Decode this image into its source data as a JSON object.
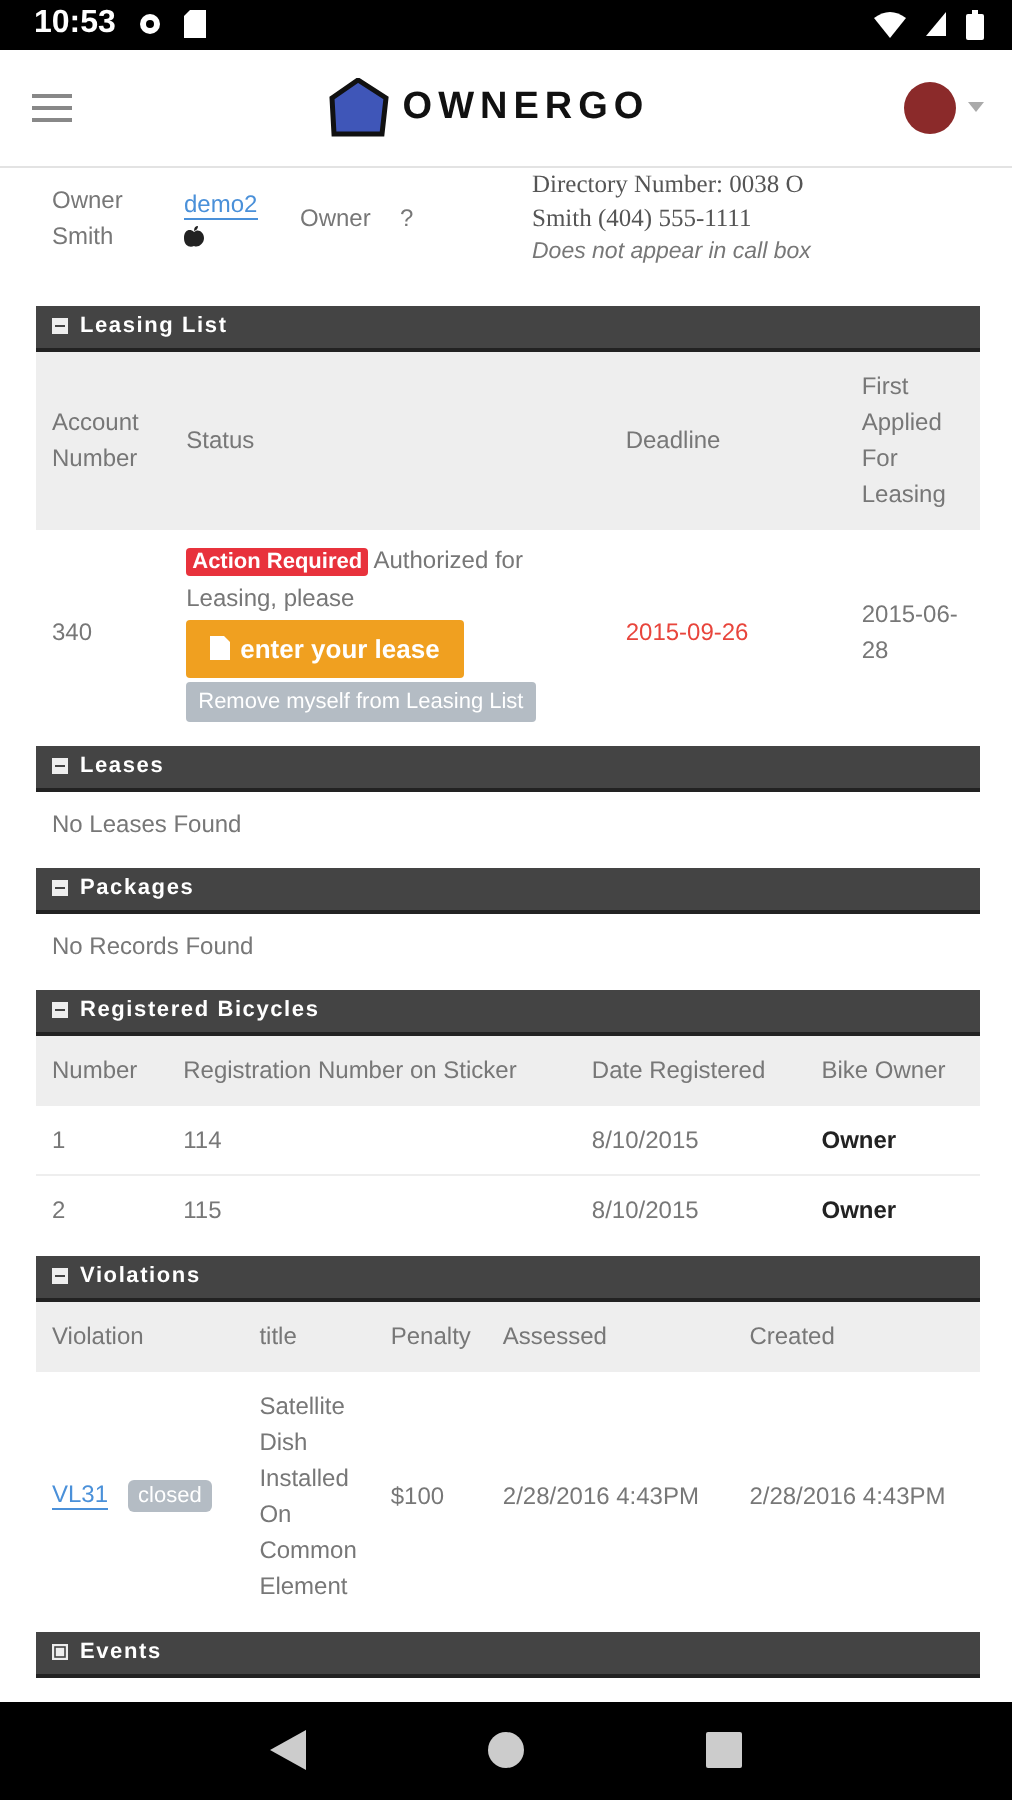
{
  "status_bar": {
    "time": "10:53"
  },
  "header": {
    "logo_text": "OWNERGO"
  },
  "resident": {
    "name": "Owner Smith",
    "username": "demo2",
    "role": "Owner",
    "flag": "?",
    "directory": "Directory Number: 0038   O",
    "contact": "Smith   (404) 555-1111",
    "note": "Does not appear in call box"
  },
  "leasing_list": {
    "title": "Leasing List",
    "expanded": true,
    "columns": [
      "Account Number",
      "Status",
      "Deadline",
      "First Applied For Leasing"
    ],
    "rows": [
      {
        "account": "340",
        "badge": "Action Required",
        "status_text": "Authorized for Leasing, please",
        "primary_button": "enter your lease",
        "secondary_button": "Remove myself from Leasing List",
        "deadline": "2015-09-26",
        "overdue": true,
        "first_applied": "2015-06-28"
      }
    ]
  },
  "leases": {
    "title": "Leases",
    "expanded": true,
    "message": "No Leases Found"
  },
  "packages": {
    "title": "Packages",
    "expanded": true,
    "message": "No Records Found"
  },
  "bicycles": {
    "title": "Registered Bicycles",
    "expanded": true,
    "columns": [
      "Number",
      "Registration Number on Sticker",
      "Date Registered",
      "Bike Owner"
    ],
    "rows": [
      [
        "1",
        "114",
        "8/10/2015",
        "Owner"
      ],
      [
        "2",
        "115",
        "8/10/2015",
        "Owner"
      ]
    ]
  },
  "violations": {
    "title": "Violations",
    "expanded": true,
    "columns": [
      "Violation",
      "title",
      "Penalty",
      "Assessed",
      "Created"
    ],
    "rows": [
      {
        "id": "VL31",
        "state": "closed",
        "title": "Satellite Dish Installed On Common Element",
        "penalty": "$100",
        "assessed": "2/28/2016 4:43PM",
        "created": "2/28/2016 4:43PM"
      }
    ]
  },
  "events": {
    "title": "Events",
    "expanded": false
  }
}
